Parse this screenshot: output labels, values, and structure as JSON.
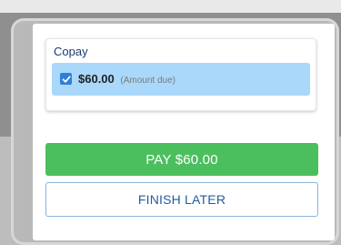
{
  "payment": {
    "section_title": "Copay",
    "selected_amount": "$60.00",
    "amount_note": "(Amount due)",
    "checkbox_checked": true
  },
  "actions": {
    "pay_label": "PAY $60.00",
    "finish_later_label": "FINISH LATER"
  },
  "colors": {
    "primary_green": "#4bbf5e",
    "selection_blue": "#a9d8fb",
    "checkbox_blue": "#2f7fd8",
    "title_navy": "#1f3c73",
    "button_outline": "#8ab4dd"
  },
  "icons": {
    "checkbox": "checkmark-icon"
  }
}
